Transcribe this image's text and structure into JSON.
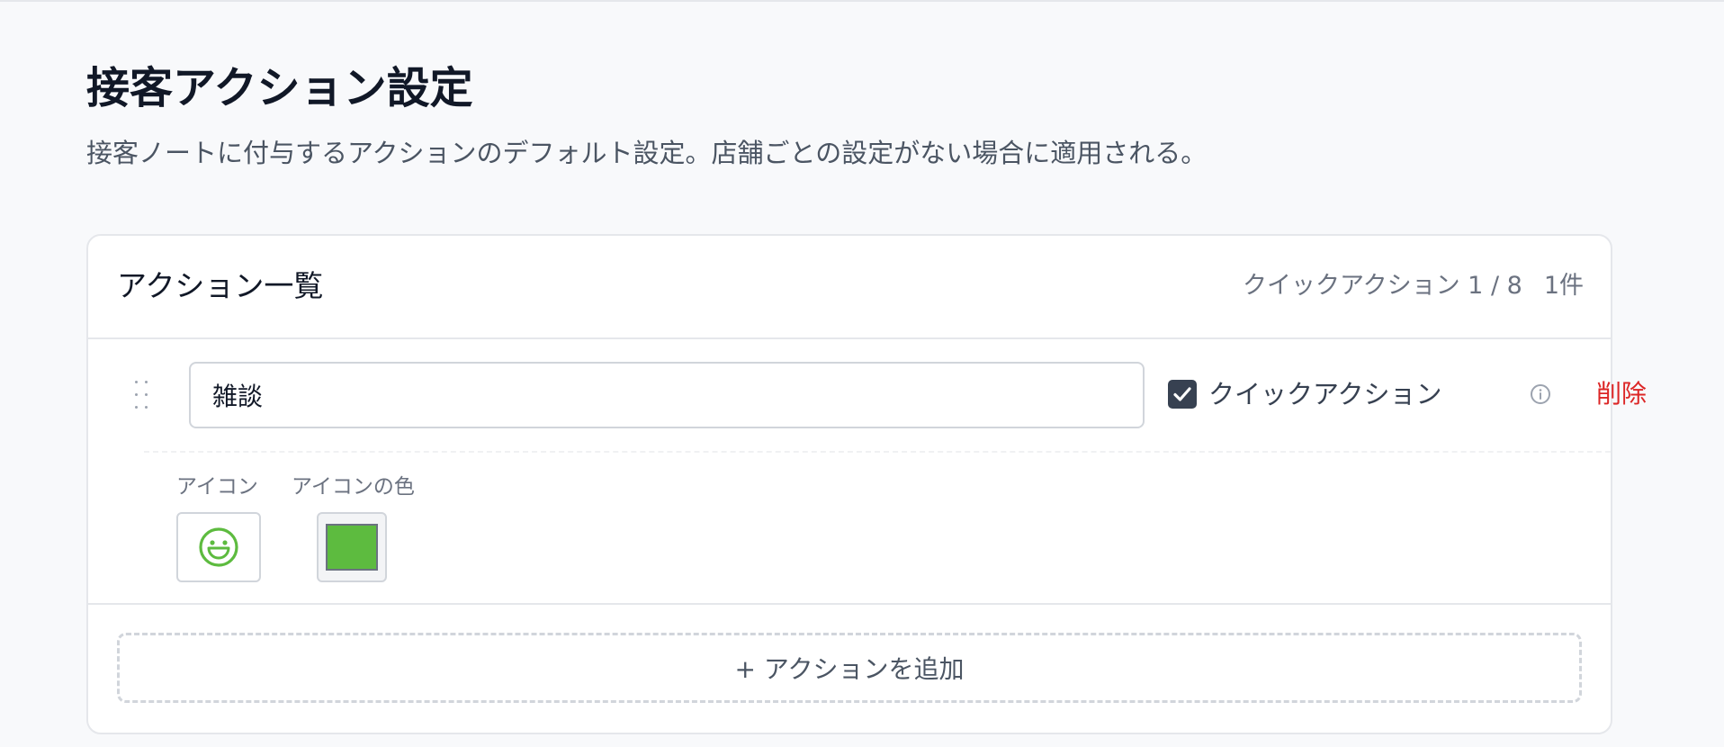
{
  "page": {
    "title": "接客アクション設定",
    "description": "接客ノートに付与するアクションのデフォルト設定。店舗ごとの設定がない場合に適用される。"
  },
  "card": {
    "title": "アクション一覧",
    "quick_action_count": "クイックアクション 1 / 8",
    "total_count": "1件"
  },
  "actions": [
    {
      "name": "雑談",
      "quick_action": true,
      "quick_action_label": "クイックアクション",
      "delete_label": "削除",
      "icon_label": "アイコン",
      "icon": "grin-face-icon",
      "color_label": "アイコンの色",
      "color": "#5dbb3f"
    }
  ],
  "add_button_label": "+ アクションを追加",
  "colors": {
    "accent_dark": "#374151",
    "danger": "#dc2626",
    "border": "#e5e7eb"
  }
}
